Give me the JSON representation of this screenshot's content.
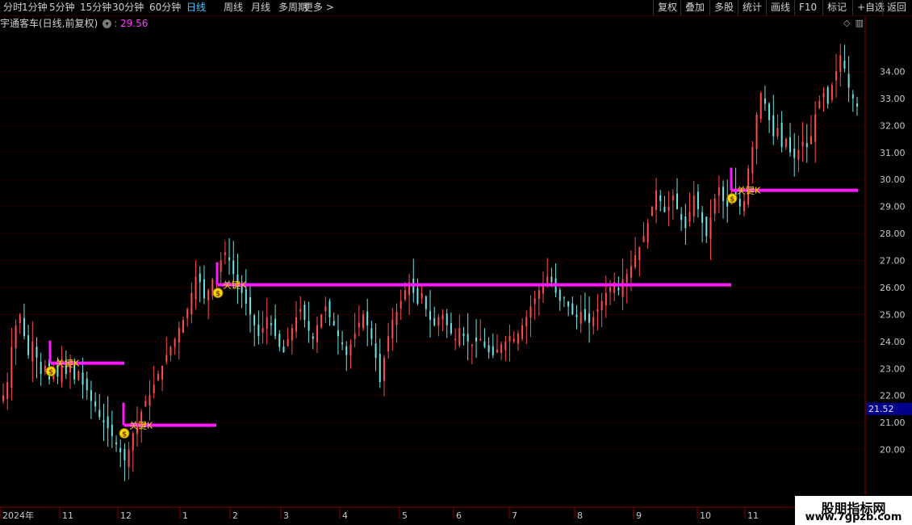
{
  "toolbar": {
    "periods": [
      "分时",
      "1分钟",
      "5分钟",
      "15分钟",
      "30分钟",
      "60分钟",
      "日线",
      "周线",
      "月线",
      "多周期",
      "更多 >"
    ],
    "active_period": "日线",
    "right_buttons": [
      "复权",
      "叠加",
      "多股",
      "统计",
      "画线",
      "F10",
      "标记",
      "+自选",
      "返回"
    ]
  },
  "info": {
    "stock_title": "宇通客车(日线,前复权)",
    "dropdown_icon": "chevron-down-icon",
    "last_price": "29.56"
  },
  "price_axis": {
    "labels": [
      "34.00",
      "33.00",
      "32.00",
      "31.00",
      "30.00",
      "29.00",
      "28.00",
      "27.00",
      "26.00",
      "25.00",
      "24.00",
      "23.00",
      "22.00",
      "21.00",
      "20.00"
    ],
    "current_marker": "21.52"
  },
  "time_axis": {
    "labels": [
      "2024年",
      "11",
      "12",
      "1",
      "2",
      "3",
      "4",
      "5",
      "6",
      "7",
      "8",
      "9",
      "10",
      "11"
    ]
  },
  "chart_data": {
    "type": "candlestick",
    "ylim": [
      19.5,
      35.0
    ],
    "grid": "horizontal dotted",
    "colors": {
      "up": "#ff4d4d",
      "down": "#6fe3e3",
      "signal_line": "#ff1aff",
      "marker": "#ffd700",
      "axis": "#8b0000"
    },
    "signals": [
      {
        "label": "关键K",
        "price": 23.2,
        "from_month": "10",
        "to_month": "11"
      },
      {
        "label": "关键K",
        "price": 20.9,
        "from_month": "12",
        "to_month": "12"
      },
      {
        "label": "关键K",
        "price": 26.1,
        "from_month": "1",
        "to_month": "9"
      },
      {
        "label": "关键K",
        "price": 29.6,
        "from_month": "10",
        "to_month": "11"
      }
    ],
    "closes": [
      22.0,
      22.5,
      23.8,
      24.6,
      25.0,
      24.2,
      23.5,
      24.0,
      23.4,
      22.8,
      23.1,
      22.6,
      23.0,
      22.7,
      23.1,
      22.8,
      23.2,
      22.6,
      22.9,
      22.4,
      22.2,
      21.8,
      21.6,
      21.2,
      21.0,
      20.8,
      20.5,
      20.2,
      19.9,
      19.6,
      20.0,
      20.6,
      20.9,
      21.4,
      21.8,
      22.0,
      22.4,
      22.8,
      23.1,
      23.5,
      23.8,
      24.1,
      24.5,
      24.8,
      25.2,
      25.8,
      26.4,
      26.2,
      25.6,
      25.9,
      26.3,
      26.6,
      27.0,
      27.3,
      27.0,
      26.5,
      26.1,
      25.8,
      25.4,
      25.0,
      24.6,
      24.2,
      24.5,
      24.9,
      24.6,
      24.2,
      23.8,
      23.6,
      24.1,
      24.5,
      24.9,
      25.2,
      24.8,
      24.4,
      24.1,
      24.6,
      25.0,
      25.3,
      24.9,
      24.6,
      24.2,
      23.9,
      23.5,
      23.9,
      24.3,
      24.7,
      25.0,
      24.6,
      24.1,
      23.4,
      22.5,
      23.4,
      24.2,
      24.8,
      25.1,
      25.5,
      25.9,
      26.2,
      25.8,
      25.4,
      25.8,
      25.2,
      24.8,
      24.6,
      24.9,
      25.0,
      24.6,
      24.3,
      24.1,
      24.5,
      24.2,
      24.0,
      23.9,
      24.0,
      24.1,
      23.8,
      23.6,
      23.5,
      23.7,
      23.9,
      24.0,
      24.2,
      24.1,
      24.3,
      24.6,
      24.9,
      25.3,
      25.6,
      25.9,
      26.1,
      26.4,
      26.2,
      25.8,
      25.5,
      25.6,
      25.3,
      25.0,
      24.9,
      25.1,
      24.8,
      24.7,
      24.9,
      25.2,
      25.5,
      25.8,
      26.0,
      26.2,
      25.9,
      26.3,
      26.5,
      26.8,
      27.2,
      27.5,
      27.9,
      28.4,
      29.0,
      29.6,
      29.2,
      28.8,
      29.0,
      29.4,
      28.9,
      28.5,
      28.2,
      28.8,
      29.4,
      28.9,
      28.4,
      27.9,
      28.6,
      29.3,
      29.7,
      29.2,
      29.0,
      29.5,
      29.3,
      29.0,
      29.2,
      30.4,
      31.2,
      32.4,
      33.2,
      32.8,
      32.2,
      31.6,
      31.9,
      31.2,
      31.5,
      31.0,
      30.8,
      31.1,
      31.4,
      31.2,
      31.6,
      32.4,
      32.9,
      33.2,
      32.8,
      33.5,
      34.0,
      34.6,
      34.1,
      33.4,
      33.0,
      32.7
    ],
    "last": "29.56"
  },
  "watermark": {
    "brand": "股朋指标网",
    "url": "www.7gpzb.com"
  }
}
